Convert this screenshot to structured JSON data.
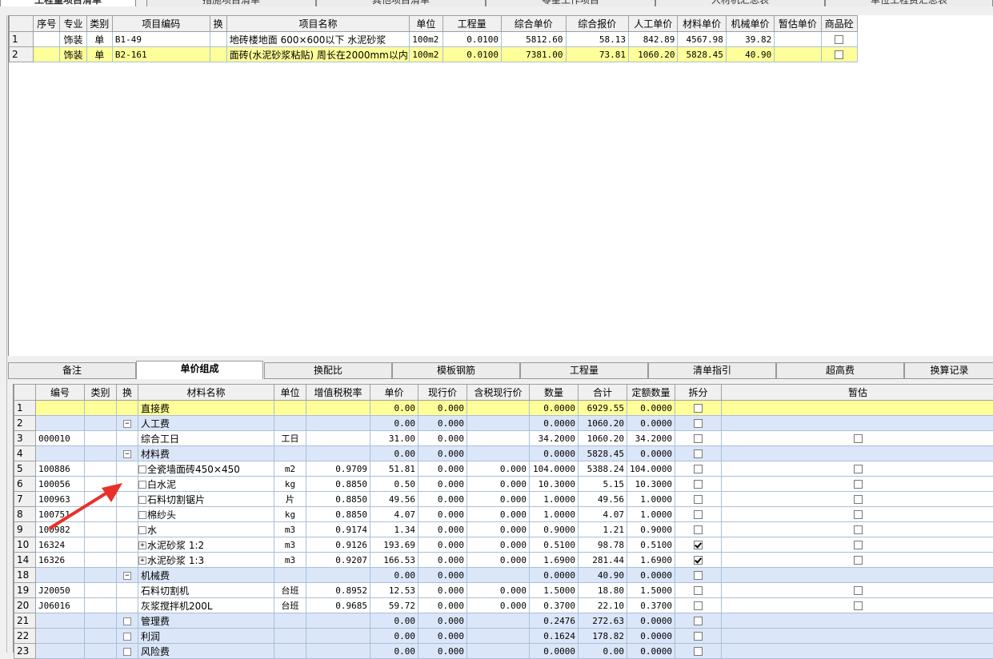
{
  "top_tabs": [
    "工程量项目清单",
    "措施项目清单",
    "其他项目清单",
    "零星工作项目",
    "人材机汇总表",
    "单位工程费汇总表"
  ],
  "upper_table": {
    "headers": [
      "序号",
      "专业",
      "类别",
      "项目编码",
      "换",
      "项目名称",
      "单位",
      "工程量",
      "综合单价",
      "综合报价",
      "人工单价",
      "材料单价",
      "机械单价",
      "暂估单价",
      "商品砼"
    ],
    "rows": [
      {
        "no": "1",
        "seq": "",
        "major": "饰装",
        "type": "单",
        "code": "B1-49",
        "swap": "",
        "name": "地砖楼地面 600×600以下 水泥砂浆",
        "unit": "100m2",
        "qty": "0.0100",
        "unit_price": "5812.60",
        "total": "58.13",
        "labor": "842.89",
        "material": "4567.98",
        "machine": "39.82",
        "est": "",
        "concrete": false
      },
      {
        "no": "2",
        "seq": "",
        "major": "饰装",
        "type": "单",
        "code": "B2-161",
        "swap": "",
        "name": "面砖(水泥砂浆粘贴) 周长在2000mm以内",
        "unit": "100m2",
        "qty": "0.0100",
        "unit_price": "7381.00",
        "total": "73.81",
        "labor": "1060.20",
        "material": "5828.45",
        "machine": "40.90",
        "est": "",
        "concrete": false
      }
    ]
  },
  "bottom_tabs": [
    "备注",
    "单价组成",
    "换配比",
    "模板钢筋",
    "工程量",
    "清单指引",
    "超高费",
    "换算记录"
  ],
  "lower_table": {
    "headers": [
      "编号",
      "类别",
      "换",
      "材料名称",
      "单位",
      "增值税税率",
      "单价",
      "现行价",
      "含税现行价",
      "数量",
      "合计",
      "定额数量",
      "拆分",
      "暂估"
    ],
    "rows": [
      {
        "no": "1",
        "code": "",
        "type": "",
        "toggle": "",
        "name": "直接费",
        "unit": "",
        "tax": "",
        "price": "0.00",
        "cur": "0.000",
        "cur_tax": "",
        "qty": "0.0000",
        "sum": "6929.55",
        "quota": "0.0000",
        "split": "unchecked",
        "est": "",
        "style": "yel",
        "indent": 0
      },
      {
        "no": "2",
        "code": "",
        "type": "",
        "toggle": "minus",
        "name": "人工费",
        "unit": "",
        "tax": "",
        "price": "0.00",
        "cur": "0.000",
        "cur_tax": "",
        "qty": "0.0000",
        "sum": "1060.20",
        "quota": "0.0000",
        "split": "unchecked",
        "est": "",
        "style": "blu",
        "indent": 0
      },
      {
        "no": "3",
        "code": "000010",
        "type": "",
        "toggle": "",
        "name": "综合工日",
        "unit": "工日",
        "tax": "",
        "price": "31.00",
        "cur": "0.000",
        "cur_tax": "",
        "qty": "34.2000",
        "sum": "1060.20",
        "quota": "34.2000",
        "split": "unchecked",
        "est": "unchecked",
        "style": "",
        "indent": 0
      },
      {
        "no": "4",
        "code": "",
        "type": "",
        "toggle": "minus",
        "name": "材料费",
        "unit": "",
        "tax": "",
        "price": "0.00",
        "cur": "0.000",
        "cur_tax": "",
        "qty": "0.0000",
        "sum": "5828.45",
        "quota": "0.0000",
        "split": "unchecked",
        "est": "",
        "style": "blu",
        "indent": 0
      },
      {
        "no": "5",
        "code": "100886",
        "type": "",
        "toggle": "box",
        "name": "全瓷墙面砖450×450",
        "unit": "m2",
        "tax": "0.9709",
        "price": "51.81",
        "cur": "0.000",
        "cur_tax": "0.000",
        "qty": "104.0000",
        "sum": "5388.24",
        "quota": "104.0000",
        "split": "unchecked",
        "est": "unchecked",
        "style": "",
        "indent": 1
      },
      {
        "no": "6",
        "code": "100056",
        "type": "",
        "toggle": "box",
        "name": "白水泥",
        "unit": "kg",
        "tax": "0.8850",
        "price": "0.50",
        "cur": "0.000",
        "cur_tax": "0.000",
        "qty": "10.3000",
        "sum": "5.15",
        "quota": "10.3000",
        "split": "unchecked",
        "est": "unchecked",
        "style": "",
        "indent": 1
      },
      {
        "no": "7",
        "code": "100963",
        "type": "",
        "toggle": "box",
        "name": "石料切割锯片",
        "unit": "片",
        "tax": "0.8850",
        "price": "49.56",
        "cur": "0.000",
        "cur_tax": "0.000",
        "qty": "1.0000",
        "sum": "49.56",
        "quota": "1.0000",
        "split": "unchecked",
        "est": "unchecked",
        "style": "",
        "indent": 1
      },
      {
        "no": "8",
        "code": "100751",
        "type": "",
        "toggle": "box",
        "name": "棉纱头",
        "unit": "kg",
        "tax": "0.8850",
        "price": "4.07",
        "cur": "0.000",
        "cur_tax": "0.000",
        "qty": "1.0000",
        "sum": "4.07",
        "quota": "1.0000",
        "split": "unchecked",
        "est": "unchecked",
        "style": "",
        "indent": 1
      },
      {
        "no": "9",
        "code": "100982",
        "type": "",
        "toggle": "box",
        "name": "水",
        "unit": "m3",
        "tax": "0.9174",
        "price": "1.34",
        "cur": "0.000",
        "cur_tax": "0.000",
        "qty": "0.9000",
        "sum": "1.21",
        "quota": "0.9000",
        "split": "unchecked",
        "est": "unchecked",
        "style": "",
        "indent": 1
      },
      {
        "no": "10",
        "code": "16324",
        "type": "",
        "toggle": "plus",
        "name": "水泥砂浆 1:2",
        "unit": "m3",
        "tax": "0.9126",
        "price": "193.69",
        "cur": "0.000",
        "cur_tax": "0.000",
        "qty": "0.5100",
        "sum": "98.78",
        "quota": "0.5100",
        "split": "checked",
        "est": "unchecked",
        "style": "",
        "indent": 1
      },
      {
        "no": "14",
        "code": "16326",
        "type": "",
        "toggle": "plus",
        "name": "水泥砂浆 1:3",
        "unit": "m3",
        "tax": "0.9207",
        "price": "166.53",
        "cur": "0.000",
        "cur_tax": "0.000",
        "qty": "1.6900",
        "sum": "281.44",
        "quota": "1.6900",
        "split": "checked",
        "est": "unchecked",
        "style": "",
        "indent": 1
      },
      {
        "no": "18",
        "code": "",
        "type": "",
        "toggle": "minus",
        "name": "机械费",
        "unit": "",
        "tax": "",
        "price": "0.00",
        "cur": "0.000",
        "cur_tax": "",
        "qty": "0.0000",
        "sum": "40.90",
        "quota": "0.0000",
        "split": "unchecked",
        "est": "",
        "style": "blu",
        "indent": 0
      },
      {
        "no": "19",
        "code": "J20050",
        "type": "",
        "toggle": "",
        "name": "石料切割机",
        "unit": "台班",
        "tax": "0.8952",
        "price": "12.53",
        "cur": "0.000",
        "cur_tax": "0.000",
        "qty": "1.5000",
        "sum": "18.80",
        "quota": "1.5000",
        "split": "unchecked",
        "est": "unchecked",
        "style": "",
        "indent": 0
      },
      {
        "no": "20",
        "code": "J06016",
        "type": "",
        "toggle": "",
        "name": "灰浆搅拌机200L",
        "unit": "台班",
        "tax": "0.9685",
        "price": "59.72",
        "cur": "0.000",
        "cur_tax": "0.000",
        "qty": "0.3700",
        "sum": "22.10",
        "quota": "0.3700",
        "split": "unchecked",
        "est": "unchecked",
        "style": "",
        "indent": 0
      },
      {
        "no": "21",
        "code": "",
        "type": "",
        "toggle": "box",
        "name": "管理费",
        "unit": "",
        "tax": "",
        "price": "0.00",
        "cur": "0.000",
        "cur_tax": "",
        "qty": "0.2476",
        "sum": "272.63",
        "quota": "0.0000",
        "split": "unchecked",
        "est": "",
        "style": "blu",
        "indent": 0
      },
      {
        "no": "22",
        "code": "",
        "type": "",
        "toggle": "box",
        "name": "利润",
        "unit": "",
        "tax": "",
        "price": "0.00",
        "cur": "0.000",
        "cur_tax": "",
        "qty": "0.1624",
        "sum": "178.82",
        "quota": "0.0000",
        "split": "unchecked",
        "est": "",
        "style": "blu",
        "indent": 0
      },
      {
        "no": "23",
        "code": "",
        "type": "",
        "toggle": "box",
        "name": "风险费",
        "unit": "",
        "tax": "",
        "price": "0.00",
        "cur": "0.000",
        "cur_tax": "",
        "qty": "0.0000",
        "sum": "0.00",
        "quota": "0.0000",
        "split": "unchecked",
        "est": "",
        "style": "blu",
        "indent": 0
      }
    ]
  },
  "annotation": {
    "arrow_color": "#e8312a"
  }
}
